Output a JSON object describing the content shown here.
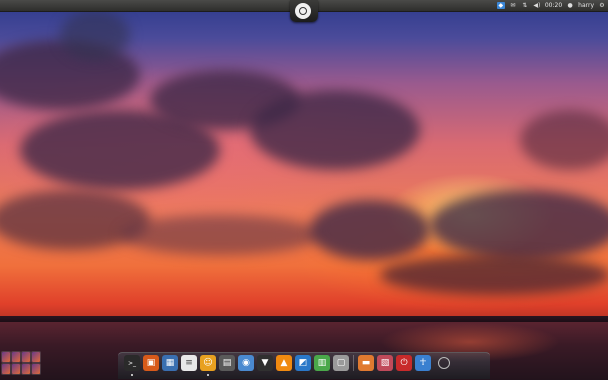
{
  "top_panel": {
    "clock": "00:20",
    "user_name": "harry",
    "tray_icons": [
      "dropbox-icon",
      "mail-icon",
      "network-icon",
      "volume-icon",
      "user-icon",
      "gear-icon"
    ]
  },
  "dock": {
    "items": [
      {
        "name": "terminal-icon",
        "color": "#2a2a2a"
      },
      {
        "name": "software-center-icon",
        "color": "#d85a1a"
      },
      {
        "name": "workspace-manager-icon",
        "color": "#3a6fb0"
      },
      {
        "name": "text-editor-icon",
        "color": "#e8e8e8"
      },
      {
        "name": "pidgin-chat-icon",
        "color": "#e8a020"
      },
      {
        "name": "system-monitor-icon",
        "color": "#5a5a5a"
      },
      {
        "name": "browser-icon",
        "color": "#4a8ad0"
      },
      {
        "name": "synaptic-icon",
        "color": "#303030"
      },
      {
        "name": "vlc-icon",
        "color": "#f08a10"
      },
      {
        "name": "virtualbox-icon",
        "color": "#2a78c8"
      },
      {
        "name": "spreadsheet-icon",
        "color": "#4aa84a"
      },
      {
        "name": "screenshot-icon",
        "color": "#9a9a9a"
      },
      {
        "name": "files-icon",
        "color": "#e07a30"
      },
      {
        "name": "image-viewer-icon",
        "color": "#c04a5a"
      },
      {
        "name": "shutdown-icon",
        "color": "#c82a2a"
      },
      {
        "name": "accessibility-icon",
        "color": "#3a80d0"
      }
    ]
  },
  "workspace_switcher": {
    "count": 8
  }
}
